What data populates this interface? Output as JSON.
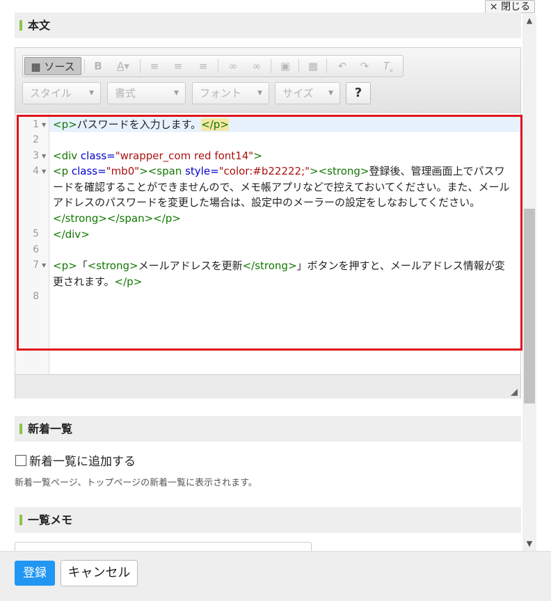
{
  "window": {
    "close_label": "× 閉じる"
  },
  "sections": {
    "body": "本文",
    "news": "新着一覧",
    "memo": "一覧メモ"
  },
  "toolbar": {
    "source_label": "ソース",
    "combos": [
      "スタイル",
      "書式",
      "フォント",
      "サイズ"
    ],
    "help_label": "?"
  },
  "editor": {
    "line_numbers": [
      "1",
      "2",
      "3",
      "4",
      "5",
      "6",
      "7",
      "8"
    ],
    "lines": {
      "l1_open": "<p>",
      "l1_text": "パスワードを入力します。",
      "l1_close": "</p>",
      "l3_open": "<div",
      "l3_attr": " class=",
      "l3_val": "\"wrapper_com red font14\"",
      "l3_end": ">",
      "l4_a": "<p",
      "l4_attr1": " class=",
      "l4_val1": "\"mb0\"",
      "l4_b": "><span",
      "l4_attr2": " style=",
      "l4_val2": "\"color:#b22222;\"",
      "l4_c": "><strong>",
      "l4_text": "登録後、管理画面上でパスワードを確認することができませんので、メモ帳アプリなどで控えておいてください。また、メールアドレスのパスワードを変更した場合は、設定中のメーラーの設定をしなおしてください。",
      "l4_d": "</strong></span></p>",
      "l5": "</div>",
      "l7_a": "<p>",
      "l7_t1": "「",
      "l7_b": "<strong>",
      "l7_t2": "メールアドレスを更新",
      "l7_c": "</strong>",
      "l7_t3": "」ボタンを押すと、メールアドレス情報が変更されます。",
      "l7_d": "</p>"
    }
  },
  "news_section": {
    "checkbox_label": "新着一覧に追加する",
    "note": "新着一覧ページ、トップページの新着一覧に表示されます。"
  },
  "footer": {
    "submit_label": "登録",
    "cancel_label": "キャンセル"
  },
  "colors": {
    "accent": "#2196f3",
    "highlight": "#e0141c",
    "section_marker": "#8bc34a"
  }
}
